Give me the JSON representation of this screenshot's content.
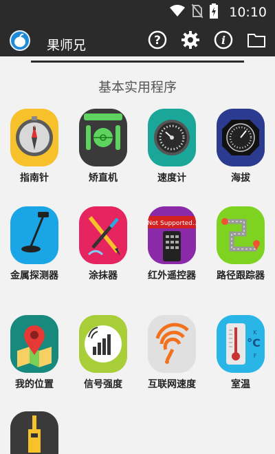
{
  "status_bar": {
    "time": "10:10",
    "icons": [
      "wifi-icon",
      "no-sim-icon",
      "battery-charging-icon"
    ]
  },
  "app_bar": {
    "logo_icon": "apple-logo-icon",
    "title": "果师兄",
    "actions": [
      "help-icon",
      "settings-icon",
      "info-icon",
      "folder-icon"
    ]
  },
  "section": {
    "title": "基本实用程序"
  },
  "tools": [
    {
      "label": "指南针",
      "icon": "compass-icon",
      "color": "#f6c12a"
    },
    {
      "label": "矫直机",
      "icon": "level-icon",
      "color": "#3a3a3a"
    },
    {
      "label": "速度计",
      "icon": "speedometer-icon",
      "color": "#1aa79a"
    },
    {
      "label": "海拔",
      "icon": "altimeter-icon",
      "color": "#2b3b8f"
    },
    {
      "label": "金属探测器",
      "icon": "metal-detector-icon",
      "color": "#1aa6e6"
    },
    {
      "label": "涂抹器",
      "icon": "paint-icon",
      "color": "#e6245f"
    },
    {
      "label": "红外遥控器",
      "icon": "remote-control-icon",
      "color": "#8a2aa8",
      "badge": "Not Supported.."
    },
    {
      "label": "路径跟踪器",
      "icon": "route-icon",
      "color": "#7ed321"
    },
    {
      "label": "我的位置",
      "icon": "location-pin-icon",
      "color": "#17897d"
    },
    {
      "label": "信号强度",
      "icon": "signal-strength-icon",
      "color": "#a8cf3a"
    },
    {
      "label": "互联网速度",
      "icon": "internet-speed-icon",
      "color": "#e0e0e0"
    },
    {
      "label": "室温",
      "icon": "thermometer-icon",
      "color": "#29b6e6"
    },
    {
      "label": "",
      "icon": "light-icon",
      "color": "#3a3a3a"
    }
  ]
}
